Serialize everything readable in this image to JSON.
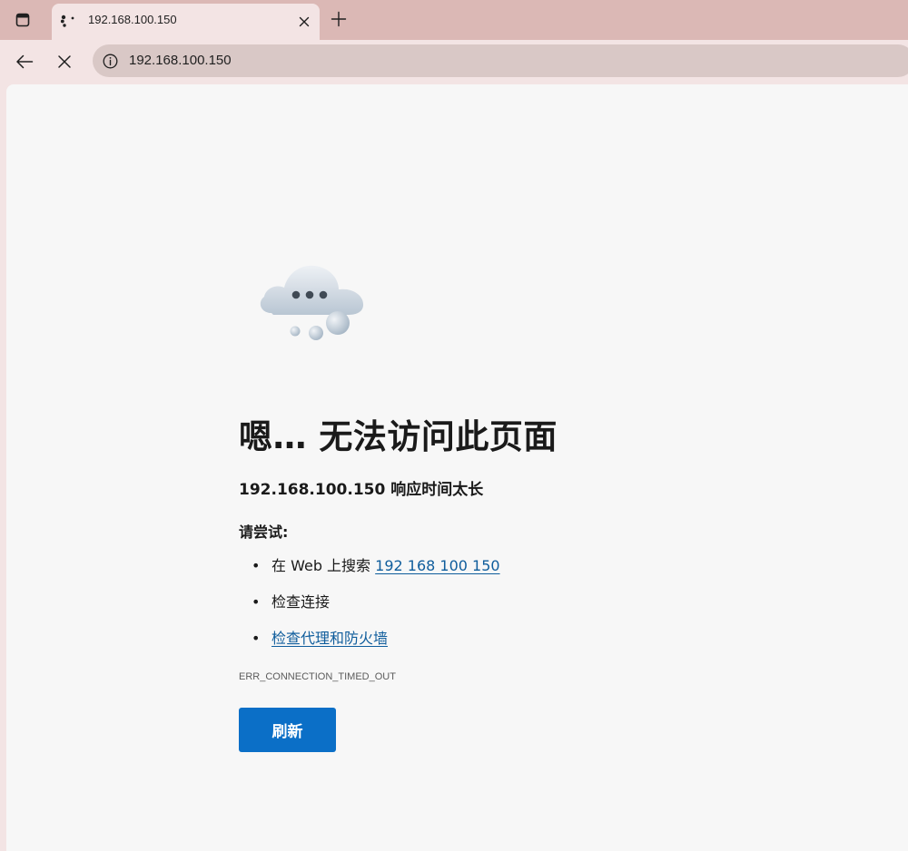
{
  "tab": {
    "title": "192.168.100.150",
    "favicon": "loading-dots-icon",
    "close_icon": "close-icon",
    "new_tab_icon": "plus-icon"
  },
  "toolbar": {
    "tab_actions_icon": "tab-actions-icon",
    "back_icon": "arrow-left-icon",
    "stop_icon": "close-icon",
    "site_info_icon": "info-icon",
    "url": "192.168.100.150"
  },
  "page": {
    "illustration": "cloud-icon",
    "heading": "嗯… 无法访问此页面",
    "subheading": "192.168.100.150 响应时间太长",
    "try_label": "请尝试:",
    "suggestions": [
      {
        "prefix": "在 Web 上搜索 ",
        "link": "192 168 100 150"
      },
      {
        "text": "检查连接"
      },
      {
        "link": "检查代理和防火墙"
      }
    ],
    "error_code": "ERR_CONNECTION_TIMED_OUT",
    "refresh_label": "刷新"
  },
  "colors": {
    "tabstrip": "#dbb8b5",
    "chrome": "#f3e4e4",
    "omnibox": "#d9c8c6",
    "page_bg": "#f7f7f7",
    "link": "#0f5d9c",
    "button": "#0b6fc7"
  }
}
